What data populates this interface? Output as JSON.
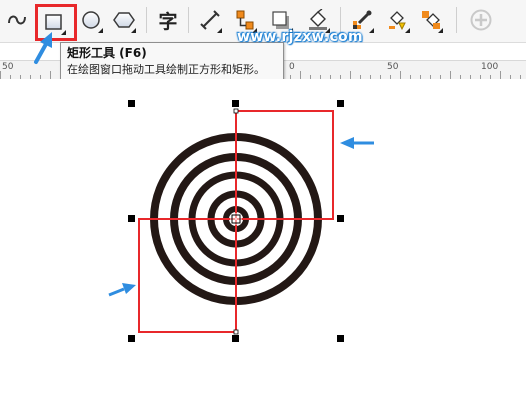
{
  "toolbar": {
    "tools": [
      {
        "name": "freehand-tool",
        "icon": "curve-icon"
      },
      {
        "name": "rectangle-tool",
        "icon": "rectangle-icon",
        "selected": true
      },
      {
        "name": "ellipse-tool",
        "icon": "ellipse-icon"
      },
      {
        "name": "polygon-tool",
        "icon": "hexagon-icon"
      },
      {
        "name": "text-tool",
        "icon": "text-icon",
        "glyph": "字"
      },
      {
        "name": "dimension-tool",
        "icon": "dimension-icon"
      },
      {
        "name": "connector-tool",
        "icon": "connector-icon"
      },
      {
        "name": "drop-shadow-tool",
        "icon": "shadow-icon"
      },
      {
        "name": "fill-tool",
        "icon": "fill-icon"
      },
      {
        "name": "eyedropper-tool",
        "icon": "eyedropper-icon"
      },
      {
        "name": "smart-fill-tool",
        "icon": "paint-bucket-icon"
      },
      {
        "name": "interactive-fill-tool",
        "icon": "interactive-fill-icon"
      },
      {
        "name": "add-tool",
        "icon": "plus-circle-icon"
      }
    ],
    "highlight_color": "#e8282b"
  },
  "tooltip": {
    "title": "矩形工具 (F6)",
    "description": "在绘图窗口拖动工具绘制正方形和矩形。"
  },
  "ruler": {
    "labels": [
      "50",
      "0",
      "50",
      "100"
    ]
  },
  "watermark": "www.rjzxw.com",
  "canvas": {
    "target_ring_color": "#231815",
    "rectangle_outline_color": "#e8282b",
    "arrow_color": "#2f8de0"
  }
}
